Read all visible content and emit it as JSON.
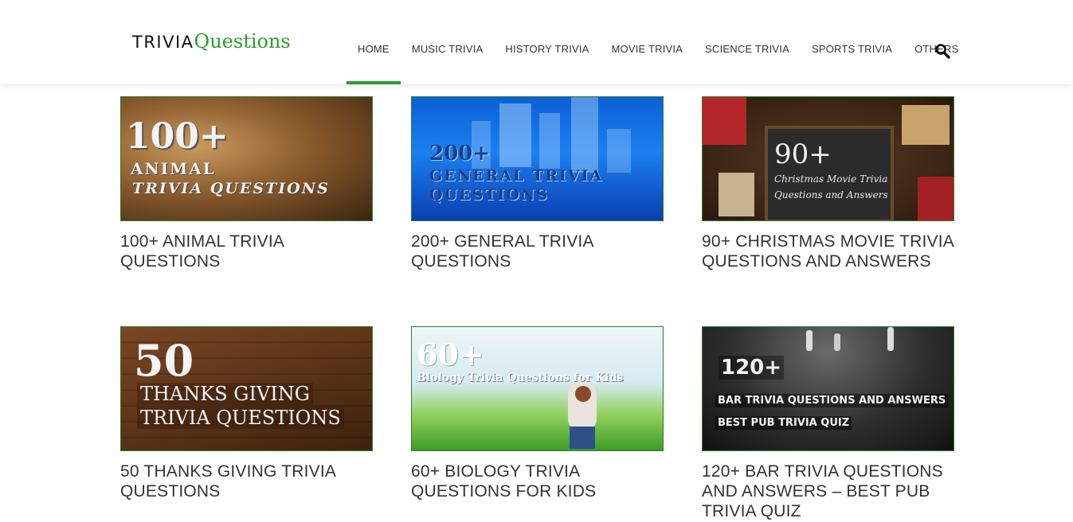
{
  "logo": {
    "part1": "TRIVIA",
    "part2": "Questions"
  },
  "nav": {
    "items": [
      {
        "label": "HOME",
        "active": true
      },
      {
        "label": "MUSIC TRIVIA",
        "active": false
      },
      {
        "label": "HISTORY TRIVIA",
        "active": false
      },
      {
        "label": "MOVIE TRIVIA",
        "active": false
      },
      {
        "label": "SCIENCE TRIVIA",
        "active": false
      },
      {
        "label": "SPORTS TRIVIA",
        "active": false
      },
      {
        "label": "OTHERS",
        "active": false
      }
    ],
    "search_icon": "search-icon",
    "accent": "#26a02e"
  },
  "posts": [
    {
      "title": "100+ ANIMAL TRIVIA QUESTIONS",
      "image_text": [
        "100+",
        "ANIMAL",
        "TRIVIA QUESTIONS"
      ]
    },
    {
      "title": "200+ GENERAL TRIVIA QUESTIONS",
      "image_text": [
        "200+",
        "GENERAL TRIVIA",
        "QUESTIONS"
      ]
    },
    {
      "title": "90+ CHRISTMAS MOVIE TRIVIA QUESTIONS AND ANSWERS",
      "image_text": [
        "90+",
        "Christmas Movie Trivia",
        "Questions and Answers"
      ]
    },
    {
      "title": "50 THANKS GIVING TRIVIA QUESTIONS",
      "image_text": [
        "50",
        "THANKS GIVING",
        "TRIVIA QUESTIONS"
      ]
    },
    {
      "title": "60+ BIOLOGY TRIVIA QUESTIONS FOR KIDS",
      "image_text": [
        "60+",
        "Biology Trivia Questions for Kids"
      ]
    },
    {
      "title": "120+ BAR TRIVIA QUESTIONS AND ANSWERS – BEST PUB TRIVIA QUIZ",
      "image_text": [
        "120+",
        "BAR TRIVIA QUESTIONS AND ANSWERS",
        "BEST PUB TRIVIA QUIZ"
      ]
    }
  ]
}
